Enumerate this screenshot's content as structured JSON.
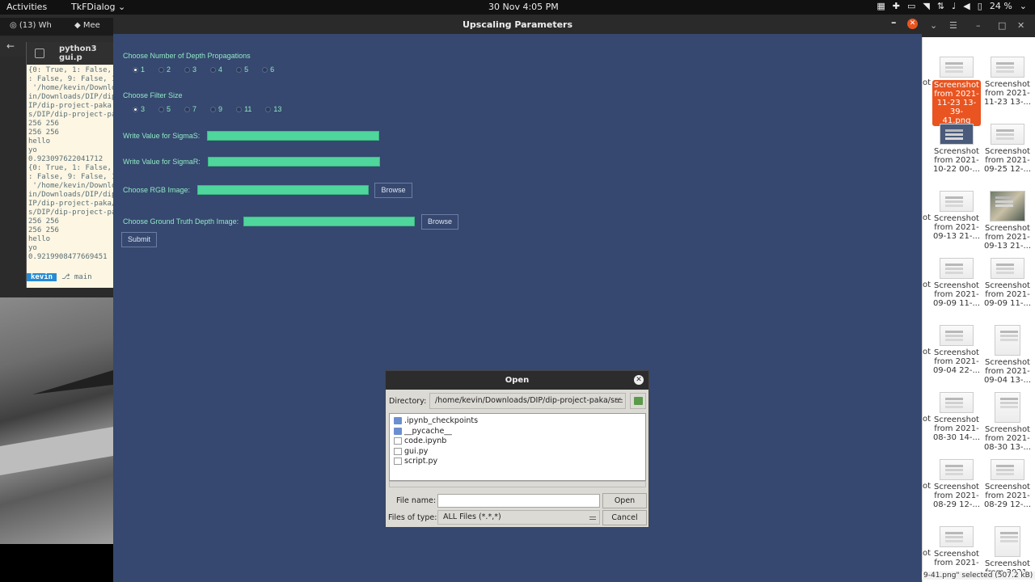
{
  "topbar": {
    "activities": "Activities",
    "app_menu": "TkFDialog",
    "clock": "30 Nov  4:05 PM",
    "battery": "24 %"
  },
  "browser": {
    "tab1": "(13) Wh",
    "tab2": "Mee"
  },
  "terminal": {
    "title": "python3 gui.p",
    "lines": [
      "{0: True, 1: False,",
      ": False, 9: False, 1",
      " '/home/kevin/Downlo",
      "in/Downloads/DIP/dip",
      "IP/dip-project-paka",
      "s/DIP/dip-project-pa",
      "256 256",
      "256 256",
      "hello",
      "yo",
      "0.923097622041712",
      "{0: True, 1: False,",
      ": False, 9: False, 1",
      " '/home/kevin/Downlo",
      "in/Downloads/DIP/dip",
      "IP/dip-project-paka/",
      "s/DIP/dip-project-pa",
      "256 256",
      "256 256",
      "hello",
      "yo",
      "0.9219908477669451"
    ],
    "prompt_user": "kevin",
    "prompt_branch": "main"
  },
  "main_window": {
    "title": "Upscaling Parameters",
    "depth_label": "Choose Number of Depth Propagations",
    "depth_options": [
      "1",
      "2",
      "3",
      "4",
      "5",
      "6"
    ],
    "depth_selected": "1",
    "filter_label": "Choose Filter Size",
    "filter_options": [
      "3",
      "5",
      "7",
      "9",
      "11",
      "13"
    ],
    "filter_selected": "3",
    "sigmas_label": "Write Value for SigmaS:",
    "sigmar_label": "Write Value for SigmaR:",
    "rgb_label": "Choose RGB Image:",
    "gt_label": "Choose Ground Truth Depth Image:",
    "browse": "Browse",
    "submit": "Submit"
  },
  "open_dialog": {
    "title": "Open",
    "directory_label": "Directory:",
    "directory": "/home/kevin/Downloads/DIP/dip-project-paka/src",
    "files": [
      {
        "name": ".ipynb_checkpoints",
        "kind": "folder"
      },
      {
        "name": "__pycache__",
        "kind": "folder"
      },
      {
        "name": "code.ipynb",
        "kind": "file"
      },
      {
        "name": "gui.py",
        "kind": "file"
      },
      {
        "name": "script.py",
        "kind": "file"
      }
    ],
    "file_name_label": "File name:",
    "file_name_value": "",
    "open_button": "Open",
    "files_of_type_label": "Files of type:",
    "files_of_type": "ALL Files (*.*,*)",
    "cancel_button": "Cancel"
  },
  "desktop": {
    "files": [
      {
        "l1": "Screenshot",
        "l2": "from 2021-",
        "l3": "11-23 13-39-",
        "l4": "41.png",
        "selected": true
      },
      {
        "l1": "Screenshot",
        "l2": "from 2021-",
        "l3": "11-23 13-...",
        "l4": ""
      },
      {
        "l1": "Screenshot",
        "l2": "from 2021-",
        "l3": "10-22 00-...",
        "l4": ""
      },
      {
        "l1": "Screenshot",
        "l2": "from 2021-",
        "l3": "09-25 12-...",
        "l4": ""
      },
      {
        "l1": "Screenshot",
        "l2": "from 2021-",
        "l3": "09-13 21-...",
        "l4": ""
      },
      {
        "l1": "Screenshot",
        "l2": "from 2021-",
        "l3": "09-13 21-...",
        "l4": ""
      },
      {
        "l1": "Screenshot",
        "l2": "from 2021-",
        "l3": "09-09 11-...",
        "l4": ""
      },
      {
        "l1": "Screenshot",
        "l2": "from 2021-",
        "l3": "09-09 11-...",
        "l4": ""
      },
      {
        "l1": "Screenshot",
        "l2": "from 2021-",
        "l3": "09-04 22-...",
        "l4": ""
      },
      {
        "l1": "Screenshot",
        "l2": "from 2021-",
        "l3": "09-04 13-...",
        "l4": ""
      },
      {
        "l1": "Screenshot",
        "l2": "from 2021-",
        "l3": "08-30 14-...",
        "l4": ""
      },
      {
        "l1": "Screenshot",
        "l2": "from 2021-",
        "l3": "08-30 13-...",
        "l4": ""
      },
      {
        "l1": "Screenshot",
        "l2": "from 2021-",
        "l3": "08-29 12-...",
        "l4": ""
      },
      {
        "l1": "Screenshot",
        "l2": "from 2021-",
        "l3": "08-29 12-...",
        "l4": ""
      },
      {
        "l1": "Screenshot",
        "l2": "from 2021-",
        "l3": "",
        "l4": ""
      },
      {
        "l1": "Screenshot",
        "l2": "from 2021-",
        "l3": "",
        "l4": ""
      }
    ],
    "cut_label": "ot",
    "status": "9-41.png\" selected  (507.2 kB)"
  }
}
